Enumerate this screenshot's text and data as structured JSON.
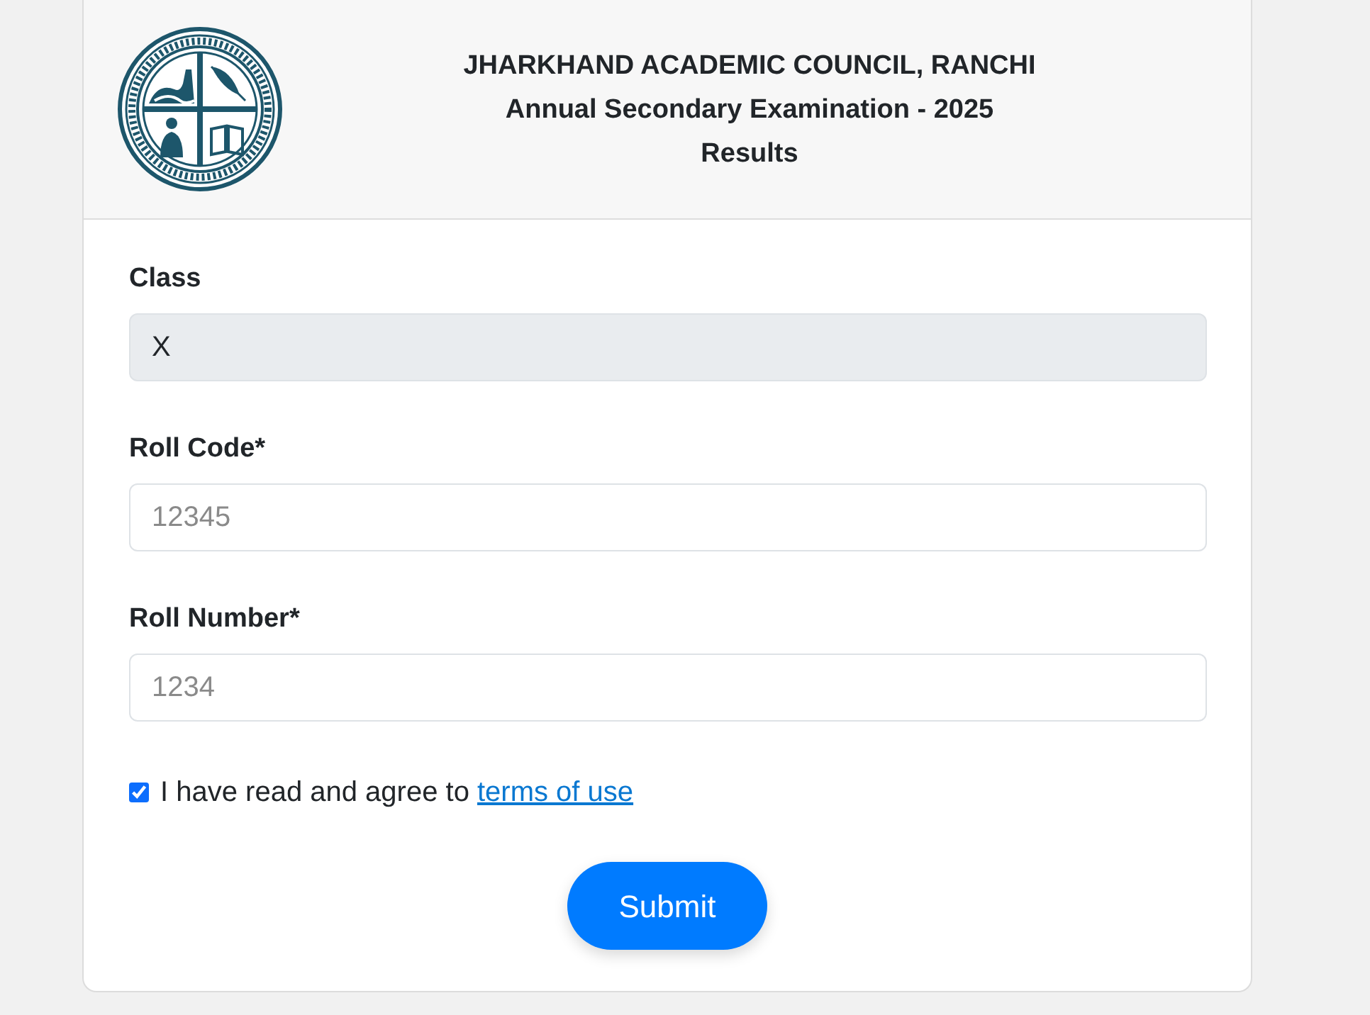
{
  "header": {
    "title_lines": [
      "JHARKHAND ACADEMIC COUNCIL, RANCHI",
      "Annual Secondary Examination - 2025",
      "Results"
    ]
  },
  "form": {
    "fields": [
      {
        "label": "Class",
        "value": "X",
        "disabled": true
      },
      {
        "label": "Roll Code*",
        "placeholder": "12345",
        "disabled": false
      },
      {
        "label": "Roll Number*",
        "placeholder": "1234",
        "disabled": false
      }
    ],
    "agreement": {
      "checked": true,
      "text": "I have read and agree to",
      "link": "terms of use"
    },
    "submit": "Submit"
  }
}
